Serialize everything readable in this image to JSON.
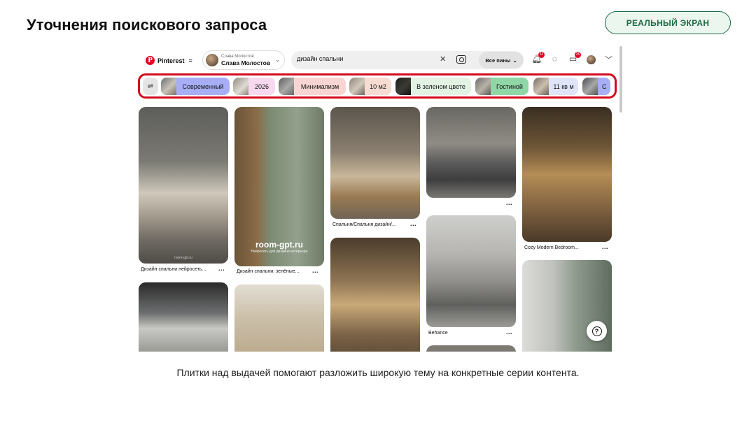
{
  "slide": {
    "title": "Уточнения поискового запроса",
    "badge": "РЕАЛЬНЫЙ ЭКРАН",
    "caption": "Плитки над выдачей помогают разложить широкую тему на конкретные серии контента."
  },
  "header": {
    "logo": "Pinterest",
    "account_small": "Слава Молостов",
    "account_name": "Слава Молостов",
    "search_value": "дизайн спальни",
    "scope_select": "Все пины",
    "notifications_count": "31",
    "messages_count": "26"
  },
  "chips": [
    {
      "label": "Современный",
      "color": "#a7aef5"
    },
    {
      "label": "2026",
      "color": "#f6d9ee"
    },
    {
      "label": "Минимализм",
      "color": "#f8d5d3"
    },
    {
      "label": "10 м2",
      "color": "#f7dcd2"
    },
    {
      "label": "В зеленом цвете",
      "color": "#e3f3e3"
    },
    {
      "label": "Гостиной",
      "color": "#8fd7a6"
    },
    {
      "label": "11 кв м",
      "color": "#dfe4f9"
    },
    {
      "label": "С",
      "color": "#a7aef5"
    }
  ],
  "pins": [
    {
      "title": "Дизайн спальни нейросеть...",
      "dots": "...",
      "watermark": "room-gpt.ru"
    },
    {
      "title": "Дизайн спальни: зелёные...",
      "dots": "...",
      "watermark": "room-gpt.ru",
      "watermark_sub": "Нейросеть для дизайна интерьера"
    },
    {
      "title": "Спальня/Спальня дизайн/...",
      "dots": "..."
    },
    {
      "title": "",
      "dots": "..."
    },
    {
      "title": "Cozy Modern Bedroom...",
      "dots": "..."
    },
    {
      "title": "Behance",
      "dots": "..."
    }
  ],
  "icons": {
    "filter": "sliders-icon",
    "help": "help-icon"
  }
}
